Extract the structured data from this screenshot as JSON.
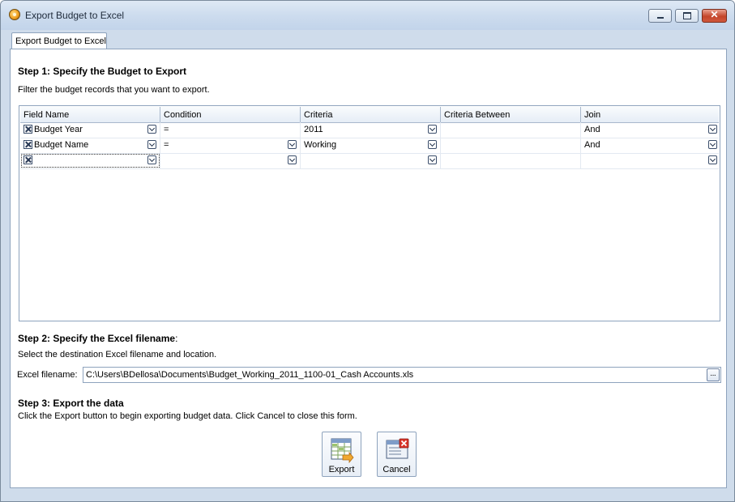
{
  "window": {
    "title": "Export Budget to Excel"
  },
  "tab": {
    "label": "Export Budget to Excel"
  },
  "step1": {
    "title": "Step 1: Specify the Budget to Export",
    "text": "Filter the budget records that you want to export."
  },
  "grid": {
    "columns": [
      "Field Name",
      "Condition",
      "Criteria",
      "Criteria Between",
      "Join"
    ],
    "rows": [
      {
        "field": "Budget Year",
        "condition": "=",
        "criteria": "2011",
        "between": "",
        "join": "And"
      },
      {
        "field": "Budget Name",
        "condition": "=",
        "criteria": "Working",
        "between": "",
        "join": "And"
      },
      {
        "field": "",
        "condition": "",
        "criteria": "",
        "between": "",
        "join": ""
      }
    ]
  },
  "step2": {
    "title": "Step 2: Specify the Excel filename",
    "title_suffix": ":",
    "text": "Select the destination Excel filename and location."
  },
  "file": {
    "label": "Excel filename:",
    "value": "C:\\Users\\BDellosa\\Documents\\Budget_Working_2011_1100-01_Cash Accounts.xls",
    "browse": "···"
  },
  "step3": {
    "title": "Step 3: Export the data",
    "text": "Click the Export button to begin exporting budget data. Click Cancel to close this form."
  },
  "buttons": {
    "export": "Export",
    "cancel": "Cancel"
  },
  "colors": {
    "panel_border": "#8ea3bd",
    "window_bg": "#cfdceb",
    "close_red": "#c4452a"
  }
}
